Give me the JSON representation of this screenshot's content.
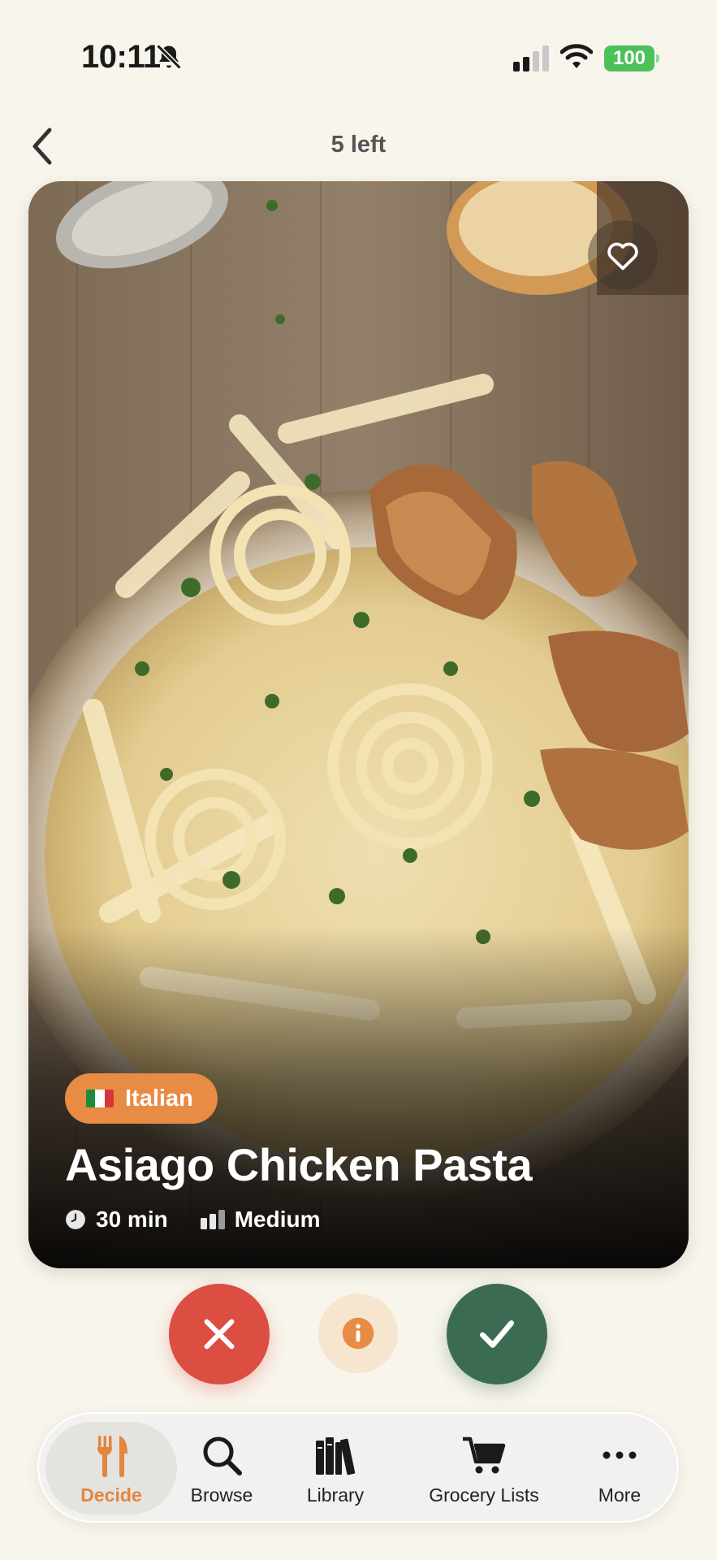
{
  "status_bar": {
    "time": "10:11",
    "battery": "100"
  },
  "header": {
    "remaining": "5 left"
  },
  "recipe": {
    "cuisine": "Italian",
    "title": "Asiago Chicken Pasta",
    "time": "30 min",
    "difficulty": "Medium"
  },
  "tabs": [
    {
      "label": "Decide",
      "icon": "utensils-icon",
      "active": true
    },
    {
      "label": "Browse",
      "icon": "search-icon"
    },
    {
      "label": "Library",
      "icon": "books-icon"
    },
    {
      "label": "Grocery Lists",
      "icon": "cart-icon"
    },
    {
      "label": "More",
      "icon": "more-icon"
    }
  ],
  "colors": {
    "accent": "#e88b45",
    "reject": "#dc4e41",
    "accept": "#3c6b53",
    "background": "#f8f5ec"
  }
}
